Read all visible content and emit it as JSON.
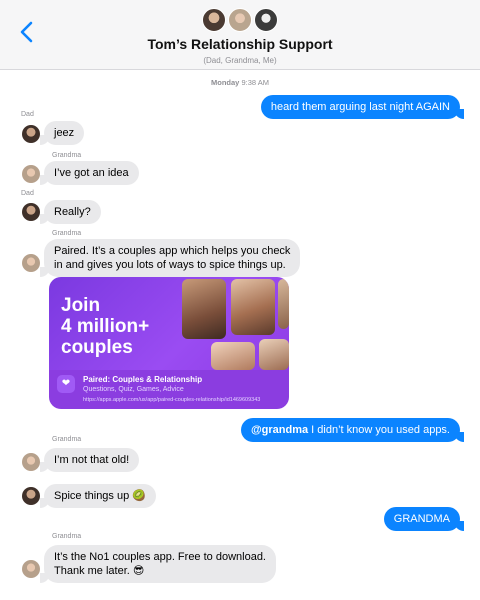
{
  "header": {
    "title": "Tom’s Relationship Support",
    "members": "(Dad, Grandma, Me)",
    "back_icon": "chevron-left-icon"
  },
  "timestamp": {
    "day": "Monday",
    "time": "9:38 AM"
  },
  "messages": [
    {
      "sender": "Me",
      "text": "heard them arguing last night AGAIN"
    },
    {
      "sender": "Dad",
      "text": "jeez"
    },
    {
      "sender": "Grandma",
      "text": "I’ve got an idea"
    },
    {
      "sender": "Dad",
      "text": "Really?"
    },
    {
      "sender": "Grandma",
      "line1": "Paired. It’s a couples app which helps you check",
      "line2": "in and gives you lots of ways to spice things up."
    },
    {
      "sender": "Me",
      "mention": "@grandma",
      "text": " I didn’t know you used apps."
    },
    {
      "sender": "Grandma",
      "text": "I’m not that old!"
    },
    {
      "sender": "Dad",
      "text": "Spice things up 🥝"
    },
    {
      "sender": "Me",
      "text": "GRANDMA"
    },
    {
      "sender": "Grandma",
      "line1": "It’s the No1 couples app. Free to download.",
      "line2": "Thank me later. 😎"
    }
  ],
  "link_card": {
    "headline1": "Join",
    "headline2": "4 million+",
    "headline3": "couples",
    "app_name": "Paired: Couples & Relationship",
    "app_categories": "Questions, Quiz, Games, Advice",
    "url": "https://apps.apple.com/us/app/paired-couples-relationship/id1469609343",
    "accent": "#8b3de0"
  },
  "colors": {
    "outgoing": "#0b84ff",
    "incoming": "#e9e9eb"
  }
}
